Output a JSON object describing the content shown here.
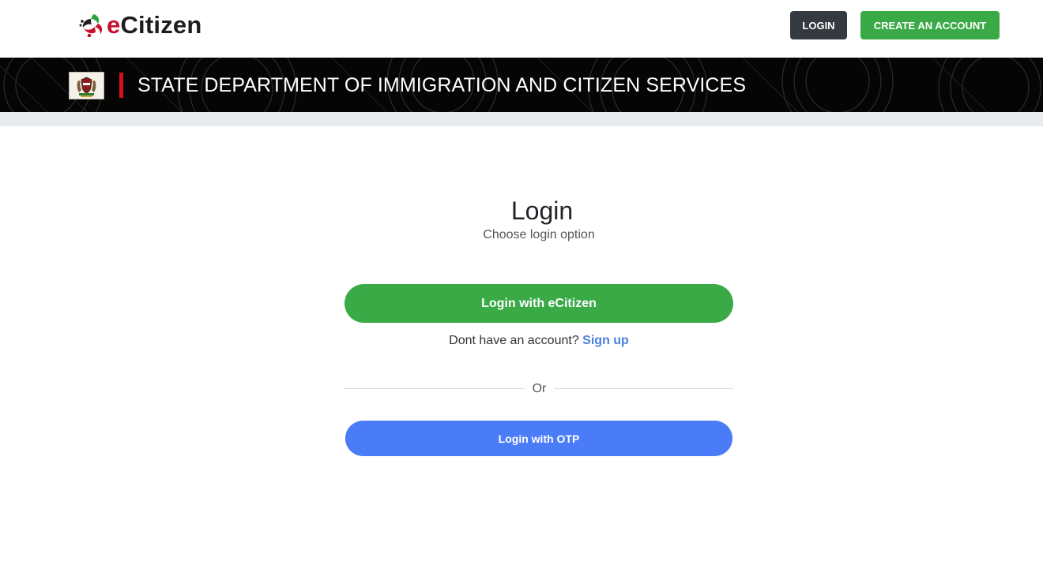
{
  "header": {
    "brand_prefix": "e",
    "brand_name": "Citizen",
    "login_button": "LOGIN",
    "create_account_button": "CREATE AN ACCOUNT"
  },
  "banner": {
    "department_title": "STATE DEPARTMENT OF IMMIGRATION AND CITIZEN SERVICES"
  },
  "main": {
    "title": "Login",
    "subtitle": "Choose login option",
    "ecitizen_button": "Login with eCitizen",
    "no_account_text": "Dont have an account?",
    "signup_link": "Sign up",
    "divider_text": "Or",
    "otp_button": "Login with OTP"
  },
  "colors": {
    "green": "#3aaa46",
    "dark_button": "#343a40",
    "blue": "#4a7cf7",
    "link_blue": "#4a7fe0",
    "accent_red": "#d1121b",
    "banner_bg": "#050505"
  },
  "icons": {
    "brand_logo": "ecitizen-logo-icon",
    "emblem": "coat-of-arms-icon"
  }
}
